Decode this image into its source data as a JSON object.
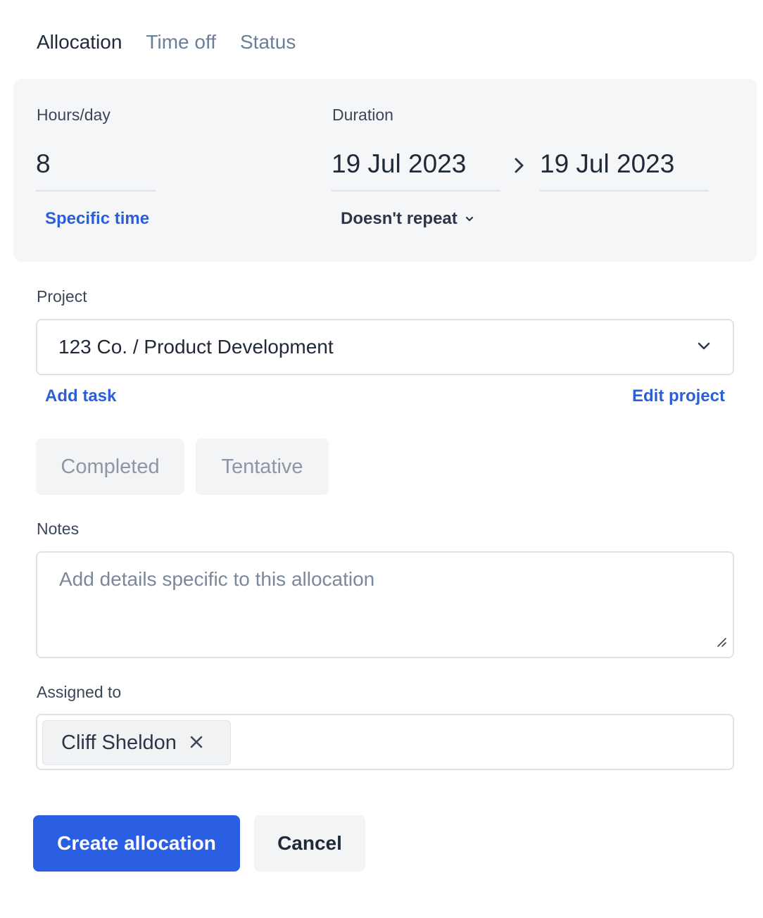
{
  "tabs": [
    {
      "label": "Allocation",
      "active": true
    },
    {
      "label": "Time off",
      "active": false
    },
    {
      "label": "Status",
      "active": false
    }
  ],
  "hours": {
    "label": "Hours/day",
    "value": "8",
    "specific_time_link": "Specific time"
  },
  "duration": {
    "label": "Duration",
    "start": "19 Jul 2023",
    "end": "19 Jul 2023",
    "repeat": "Doesn't repeat"
  },
  "project": {
    "label": "Project",
    "value": "123 Co. / Product Development",
    "add_task": "Add task",
    "edit_project": "Edit project"
  },
  "status_buttons": {
    "completed": "Completed",
    "tentative": "Tentative"
  },
  "notes": {
    "label": "Notes",
    "placeholder": "Add details specific to this allocation"
  },
  "assigned": {
    "label": "Assigned to",
    "people": [
      "Cliff Sheldon"
    ]
  },
  "actions": {
    "create": "Create allocation",
    "cancel": "Cancel"
  },
  "colors": {
    "primary": "#2b5fe3",
    "link": "#2c5fd6",
    "panel_bg": "#f5f6f8",
    "border": "#dfe3e8"
  }
}
